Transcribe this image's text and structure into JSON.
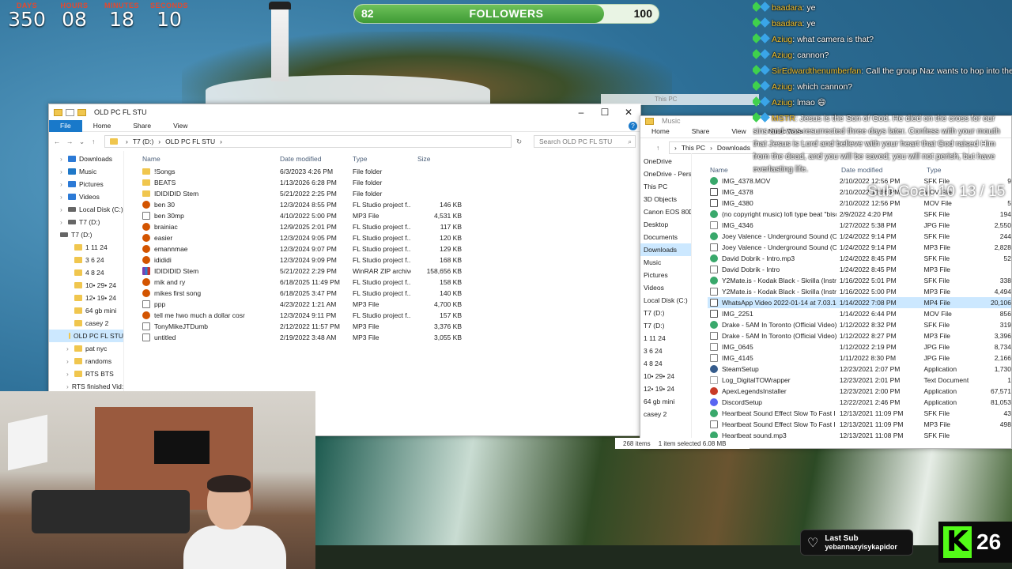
{
  "countdown": [
    {
      "label": "DAYS",
      "value": "350"
    },
    {
      "label": "HOURS",
      "value": "08"
    },
    {
      "label": "MINUTES",
      "value": "18"
    },
    {
      "label": "SECONDS",
      "value": "10"
    }
  ],
  "followers": {
    "current": "82",
    "title": "FOLLOWERS",
    "goal": "100",
    "progress": 0.82
  },
  "chat": [
    {
      "user": "baadara",
      "text": ": ye"
    },
    {
      "user": "baadara",
      "text": ": ye"
    },
    {
      "user": "Aziug",
      "text": ": what camera is that?"
    },
    {
      "user": "Aziug",
      "text": ": cannon?"
    },
    {
      "user": "SirEdwardthenumberfan",
      "text": ": Call the group Naz wants to hop into the ft"
    },
    {
      "user": "Aziug",
      "text": ": which cannon?"
    },
    {
      "user": "Aziug",
      "text": ": lmao 😄"
    },
    {
      "user": "MSTR",
      "text": ": Jesus is the Son of God. He died on the cross for our sins and was resurrected three days later. Confess with your mouth that Jesus is Lord and believe with your heart that God raised Him from the dead, and you will be saved; you will not perish, but have everlasting life."
    }
  ],
  "subgoal": "Sub Goal: 10  13 / 15",
  "left_window": {
    "title": "OLD PC FL STU",
    "ribbon": [
      "File",
      "Home",
      "Share",
      "View"
    ],
    "path": [
      "T7 (D:)",
      "OLD PC FL STU"
    ],
    "search_placeholder": "Search OLD PC FL STU",
    "columns": {
      "name": "Name",
      "date": "Date modified",
      "type": "Type",
      "size": "Size"
    },
    "nav": [
      {
        "label": "Downloads",
        "icon": "downloads-icon"
      },
      {
        "label": "Music",
        "icon": "music-icon"
      },
      {
        "label": "Pictures",
        "icon": "pictures-icon"
      },
      {
        "label": "Videos",
        "icon": "videos-icon"
      },
      {
        "label": "Local Disk (C:)",
        "icon": "drive-icon"
      },
      {
        "label": "T7 (D:)",
        "icon": "drive-icon"
      },
      {
        "label": "T7 (D:)",
        "icon": "drive-icon"
      },
      {
        "label": "1 11 24",
        "icon": "folder-icon"
      },
      {
        "label": "3 6 24",
        "icon": "folder-icon"
      },
      {
        "label": "4 8 24",
        "icon": "folder-icon"
      },
      {
        "label": "10• 29• 24",
        "icon": "folder-icon"
      },
      {
        "label": "12• 19• 24",
        "icon": "folder-icon"
      },
      {
        "label": "64 gb mini",
        "icon": "folder-icon"
      },
      {
        "label": "casey 2",
        "icon": "folder-icon"
      },
      {
        "label": "OLD PC FL STU",
        "icon": "folder-icon"
      },
      {
        "label": "pat nyc",
        "icon": "folder-icon"
      },
      {
        "label": "randoms",
        "icon": "folder-icon"
      },
      {
        "label": "RTS BTS",
        "icon": "folder-icon"
      },
      {
        "label": "RTS finished Vid:",
        "icon": "folder-icon"
      }
    ],
    "files": [
      {
        "name": "!Songs",
        "date": "6/3/2023 4:26 PM",
        "type": "File folder",
        "size": "",
        "icon": "folder"
      },
      {
        "name": "BEATS",
        "date": "1/13/2026 6:28 PM",
        "type": "File folder",
        "size": "",
        "icon": "folder"
      },
      {
        "name": "IDIDIDID Stem",
        "date": "5/21/2022 2:25 PM",
        "type": "File folder",
        "size": "",
        "icon": "folder"
      },
      {
        "name": "ben 30",
        "date": "12/3/2024 8:55 PM",
        "type": "FL Studio project f...",
        "size": "146 KB",
        "icon": "flp"
      },
      {
        "name": "ben 30mp",
        "date": "4/10/2022 5:00 PM",
        "type": "MP3 File",
        "size": "4,531 KB",
        "icon": "mp3"
      },
      {
        "name": "brainiac",
        "date": "12/9/2025 2:01 PM",
        "type": "FL Studio project f...",
        "size": "117 KB",
        "icon": "flp"
      },
      {
        "name": "easier",
        "date": "12/3/2024 9:05 PM",
        "type": "FL Studio project f...",
        "size": "120 KB",
        "icon": "flp"
      },
      {
        "name": "emannmae",
        "date": "12/3/2024 9:07 PM",
        "type": "FL Studio project f...",
        "size": "129 KB",
        "icon": "flp"
      },
      {
        "name": "idididi",
        "date": "12/3/2024 9:09 PM",
        "type": "FL Studio project f...",
        "size": "168 KB",
        "icon": "flp"
      },
      {
        "name": "IDIDIDID Stem",
        "date": "5/21/2022 2:29 PM",
        "type": "WinRAR ZIP archive",
        "size": "158,656 KB",
        "icon": "zip"
      },
      {
        "name": "mik and ry",
        "date": "6/18/2025 11:49 PM",
        "type": "FL Studio project f...",
        "size": "158 KB",
        "icon": "flp"
      },
      {
        "name": "mikes first song",
        "date": "6/18/2025 3:47 PM",
        "type": "FL Studio project f...",
        "size": "140 KB",
        "icon": "flp"
      },
      {
        "name": "ppp",
        "date": "4/23/2022 1:21 AM",
        "type": "MP3 File",
        "size": "4,700 KB",
        "icon": "mp3"
      },
      {
        "name": "tell me hwo much a dollar cosr",
        "date": "12/3/2024 9:11 PM",
        "type": "FL Studio project f...",
        "size": "157 KB",
        "icon": "flp"
      },
      {
        "name": "TonyMikeJTDumb",
        "date": "2/12/2022 11:57 PM",
        "type": "MP3 File",
        "size": "3,376 KB",
        "icon": "mp3"
      },
      {
        "name": "untitled",
        "date": "2/19/2022 3:48 AM",
        "type": "MP3 File",
        "size": "3,055 KB",
        "icon": "mp3"
      }
    ]
  },
  "right_window": {
    "ghost_title_1": "This PC",
    "title": "Music",
    "ribbon": [
      "Home",
      "Share",
      "View",
      "Music Tools"
    ],
    "path": [
      "This PC",
      "Downloads"
    ],
    "columns": {
      "name": "Name",
      "date": "Date modified",
      "type": "Type"
    },
    "nav": [
      "OneDrive",
      "OneDrive - Person",
      "This PC",
      "3D Objects",
      "Canon EOS 80D",
      "Desktop",
      "Documents",
      "Downloads",
      "Music",
      "Pictures",
      "Videos",
      "Local Disk (C:)",
      "T7 (D:)",
      "T7 (D:)",
      "1 11 24",
      "3 6 24",
      "4 8 24",
      "10• 29• 24",
      "12• 19• 24",
      "64 gb mini",
      "casey 2"
    ],
    "files": [
      {
        "name": "IMG_4378.MOV",
        "date": "2/10/2022 12:56 PM",
        "type": "SFK File",
        "size": "9",
        "icon": "sfk"
      },
      {
        "name": "IMG_4378",
        "date": "2/10/2022 12:56 PM",
        "type": "MOV File",
        "size": "",
        "icon": "vid"
      },
      {
        "name": "IMG_4380",
        "date": "2/10/2022 12:56 PM",
        "type": "MOV File",
        "size": "5",
        "icon": "vid"
      },
      {
        "name": "(no copyright music) lofi type beat \"bisc...",
        "date": "2/9/2022 4:20 PM",
        "type": "SFK File",
        "size": "194",
        "icon": "sfk"
      },
      {
        "name": "IMG_4346",
        "date": "1/27/2022 5:38 PM",
        "type": "JPG File",
        "size": "2,550",
        "icon": "jpg"
      },
      {
        "name": "Joey Valence - Underground Sound (Offi...",
        "date": "1/24/2022 9:14 PM",
        "type": "SFK File",
        "size": "244",
        "icon": "sfk"
      },
      {
        "name": "Joey Valence - Underground Sound (Offi...",
        "date": "1/24/2022 9:14 PM",
        "type": "MP3 File",
        "size": "2,828",
        "icon": "mp3"
      },
      {
        "name": "David Dobrik - Intro.mp3",
        "date": "1/24/2022 8:45 PM",
        "type": "SFK File",
        "size": "52",
        "icon": "sfk"
      },
      {
        "name": "David Dobrik - Intro",
        "date": "1/24/2022 8:45 PM",
        "type": "MP3 File",
        "size": "",
        "icon": "mp3"
      },
      {
        "name": "Y2Mate.is - Kodak Black - Skrilla (Instrum...",
        "date": "1/16/2022 5:01 PM",
        "type": "SFK File",
        "size": "338",
        "icon": "sfk"
      },
      {
        "name": "Y2Mate.is - Kodak Black - Skrilla (Instrum...",
        "date": "1/16/2022 5:00 PM",
        "type": "MP3 File",
        "size": "4,494",
        "icon": "mp3"
      },
      {
        "name": "WhatsApp Video 2022-01-14 at 7.03.14 PM",
        "date": "1/14/2022 7:08 PM",
        "type": "MP4 File",
        "size": "20,106",
        "icon": "vid",
        "selected": true
      },
      {
        "name": "IMG_2251",
        "date": "1/14/2022 6:44 PM",
        "type": "MOV File",
        "size": "856",
        "icon": "vid"
      },
      {
        "name": "Drake - 5AM In Toronto (Official Video)....",
        "date": "1/12/2022 8:32 PM",
        "type": "SFK File",
        "size": "319",
        "icon": "sfk"
      },
      {
        "name": "Drake - 5AM In Toronto (Official Video)",
        "date": "1/12/2022 8:27 PM",
        "type": "MP3 File",
        "size": "3,396",
        "icon": "mp3"
      },
      {
        "name": "IMG_0645",
        "date": "1/12/2022 2:19 PM",
        "type": "JPG File",
        "size": "8,734",
        "icon": "jpg"
      },
      {
        "name": "IMG_4145",
        "date": "1/11/2022 8:30 PM",
        "type": "JPG File",
        "size": "2,166",
        "icon": "jpg"
      },
      {
        "name": "SteamSetup",
        "date": "12/23/2021 2:07 PM",
        "type": "Application",
        "size": "1,730",
        "icon": "app"
      },
      {
        "name": "Log_DigitalTOWrapper",
        "date": "12/23/2021 2:01 PM",
        "type": "Text Document",
        "size": "1",
        "icon": "txt"
      },
      {
        "name": "ApexLegendsInstaller",
        "date": "12/23/2021 2:00 PM",
        "type": "Application",
        "size": "67,571",
        "icon": "apex"
      },
      {
        "name": "DiscordSetup",
        "date": "12/22/2021 2:46 PM",
        "type": "Application",
        "size": "81,053",
        "icon": "discord"
      },
      {
        "name": "Heartbeat Sound Effect Slow To Fast I He...",
        "date": "12/13/2021 11:09 PM",
        "type": "SFK File",
        "size": "43",
        "icon": "sfk"
      },
      {
        "name": "Heartbeat Sound Effect Slow To Fast I He...",
        "date": "12/13/2021 11:09 PM",
        "type": "MP3 File",
        "size": "498",
        "icon": "mp3"
      },
      {
        "name": "Heartbeat sound.mp3",
        "date": "12/13/2021 11:08 PM",
        "type": "SFK File",
        "size": "",
        "icon": "sfk"
      }
    ],
    "status": {
      "items": "268 items",
      "selected": "1 item selected  6.08 MB"
    }
  },
  "last_sub": {
    "title": "Last Sub",
    "name": "yebannaxyisykapidor"
  },
  "kick": {
    "count": "26",
    "logo": "K"
  }
}
